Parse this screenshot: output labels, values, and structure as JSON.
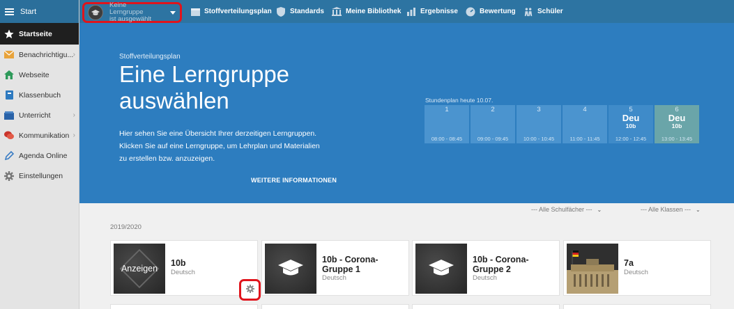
{
  "sidebar": {
    "top_label": "Start",
    "items": [
      {
        "label": "Startseite",
        "icon": "star-icon",
        "active": true
      },
      {
        "label": "Benachrichtigu...",
        "icon": "envelope-icon",
        "chevron": true
      },
      {
        "label": "Webseite",
        "icon": "house-icon"
      },
      {
        "label": "Klassenbuch",
        "icon": "book-icon"
      },
      {
        "label": "Unterricht",
        "icon": "books-icon",
        "chevron": true
      },
      {
        "label": "Kommunikation",
        "icon": "chat-icon",
        "chevron": true
      },
      {
        "label": "Agenda Online",
        "icon": "pencil-icon"
      },
      {
        "label": "Einstellungen",
        "icon": "gear-icon"
      }
    ]
  },
  "topbar": {
    "learning_group_select": {
      "line1": "Keine Lerngruppe",
      "line2": "ist ausgewählt"
    },
    "nav": [
      {
        "label": "Stoffverteilungsplan",
        "icon": "calendar-icon"
      },
      {
        "label": "Standards",
        "icon": "shield-icon"
      },
      {
        "label": "Meine Bibliothek",
        "icon": "library-icon"
      },
      {
        "label": "Ergebnisse",
        "icon": "bar-chart-icon"
      },
      {
        "label": "Bewertung",
        "icon": "gauge-icon"
      },
      {
        "label": "Schüler",
        "icon": "students-icon"
      }
    ]
  },
  "hero": {
    "kicker": "Stoffverteilungsplan",
    "title_line1": "Eine Lerngruppe",
    "title_line2": "auswählen",
    "desc_line1": "Hier sehen Sie eine Übersicht Ihrer derzeitigen Lerngruppen.",
    "desc_line2": "Klicken Sie auf eine Lerngruppe, um Lehrplan und Materialien",
    "desc_line3": "zu erstellen bzw. anzuzeigen.",
    "more_link": "WEITERE INFORMATIONEN",
    "schedule": {
      "title": "Stundenplan heute 10.07.",
      "slots": [
        {
          "num": "1",
          "subject": "",
          "class": "",
          "time": "08:00 - 08:45"
        },
        {
          "num": "2",
          "subject": "",
          "class": "",
          "time": "09:00 - 09:45"
        },
        {
          "num": "3",
          "subject": "",
          "class": "",
          "time": "10:00 - 10:45"
        },
        {
          "num": "4",
          "subject": "",
          "class": "",
          "time": "11:00 - 11:45"
        },
        {
          "num": "5",
          "subject": "Deu",
          "class": "10b",
          "time": "12:00 - 12:45"
        },
        {
          "num": "6",
          "subject": "Deu",
          "class": "10b",
          "time": "13:00 - 13:45"
        }
      ]
    }
  },
  "content": {
    "filter_subjects": "--- Alle Schulfächer ---",
    "filter_classes": "--- Alle Klassen ---",
    "year": "2019/2020",
    "cards": [
      {
        "title": "10b",
        "subject": "Deutsch",
        "thumb_label": "Anzeigen"
      },
      {
        "title": "10b - Corona-Gruppe 1",
        "subject": "Deutsch"
      },
      {
        "title": "10b - Corona-Gruppe 2",
        "subject": "Deutsch"
      },
      {
        "title": "7a",
        "subject": "Deutsch"
      }
    ]
  },
  "colors": {
    "topbar": "#2d74a2",
    "hero": "#2d7dbf",
    "highlight": "#e0141c"
  }
}
